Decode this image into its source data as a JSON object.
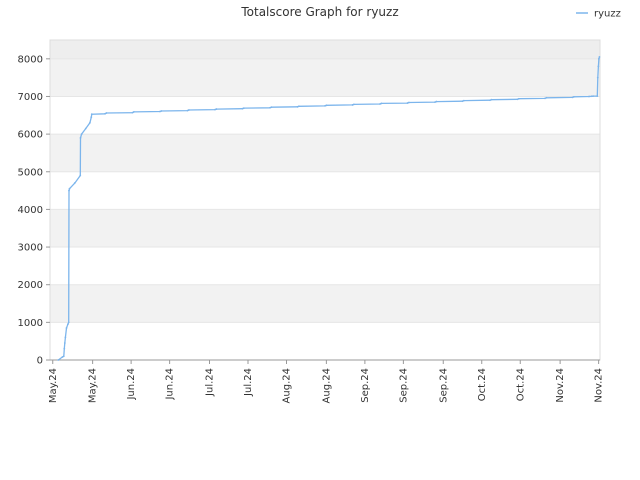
{
  "chart_data": {
    "type": "line",
    "title": "Totalscore Graph for ryuzz",
    "xlabel": "",
    "ylabel": "",
    "ylim": [
      0,
      8500
    ],
    "y_ticks": [
      0,
      1000,
      2000,
      3000,
      4000,
      5000,
      6000,
      7000,
      8000
    ],
    "x_tick_labels": [
      "May.24",
      "May.24",
      "Jun.24",
      "Jun.24",
      "Jul.24",
      "Jul.24",
      "Aug.24",
      "Aug.24",
      "Sep.24",
      "Sep.24",
      "Sep.24",
      "Oct.24",
      "Oct.24",
      "Nov.24",
      "Nov.24"
    ],
    "x_range_days": [
      0,
      200
    ],
    "x_tick_days": [
      1,
      15.5,
      29.5,
      43.5,
      58,
      72,
      86,
      100.5,
      114.5,
      128.5,
      143,
      157,
      171,
      185.5,
      199.5
    ],
    "grid": true,
    "legend_position": "top-right",
    "series": [
      {
        "name": "ryuzz",
        "color": "#7cb5ec",
        "points": [
          [
            3,
            0
          ],
          [
            4.5,
            80
          ],
          [
            5,
            100
          ],
          [
            5.2,
            300
          ],
          [
            5.4,
            450
          ],
          [
            5.6,
            600
          ],
          [
            6,
            850
          ],
          [
            6.5,
            950
          ],
          [
            6.8,
            1000
          ],
          [
            6.9,
            4500
          ],
          [
            7.1,
            4550
          ],
          [
            9,
            4700
          ],
          [
            11,
            4900
          ],
          [
            11.1,
            5900
          ],
          [
            11.5,
            6000
          ],
          [
            13,
            6150
          ],
          [
            14.5,
            6300
          ],
          [
            15,
            6450
          ],
          [
            15.2,
            6530
          ],
          [
            20,
            6540
          ],
          [
            20.5,
            6560
          ],
          [
            30,
            6570
          ],
          [
            30.5,
            6590
          ],
          [
            40,
            6600
          ],
          [
            40.5,
            6615
          ],
          [
            50,
            6625
          ],
          [
            50.5,
            6640
          ],
          [
            60,
            6650
          ],
          [
            60.5,
            6665
          ],
          [
            70,
            6675
          ],
          [
            70.5,
            6690
          ],
          [
            80,
            6700
          ],
          [
            80.5,
            6715
          ],
          [
            90,
            6725
          ],
          [
            90.5,
            6740
          ],
          [
            100,
            6750
          ],
          [
            100.5,
            6765
          ],
          [
            110,
            6775
          ],
          [
            110.5,
            6790
          ],
          [
            120,
            6800
          ],
          [
            120.5,
            6815
          ],
          [
            130,
            6825
          ],
          [
            130.5,
            6840
          ],
          [
            140,
            6850
          ],
          [
            140.5,
            6865
          ],
          [
            150,
            6875
          ],
          [
            150.5,
            6890
          ],
          [
            160,
            6900
          ],
          [
            160.5,
            6915
          ],
          [
            170,
            6925
          ],
          [
            170.5,
            6940
          ],
          [
            180,
            6950
          ],
          [
            180.5,
            6965
          ],
          [
            190,
            6975
          ],
          [
            190.5,
            6990
          ],
          [
            196,
            7000
          ],
          [
            197,
            7005
          ],
          [
            197.5,
            7010
          ],
          [
            199,
            7010
          ],
          [
            199.2,
            7500
          ],
          [
            199.4,
            7800
          ],
          [
            199.6,
            8000
          ],
          [
            199.8,
            8050
          ]
        ]
      }
    ]
  }
}
